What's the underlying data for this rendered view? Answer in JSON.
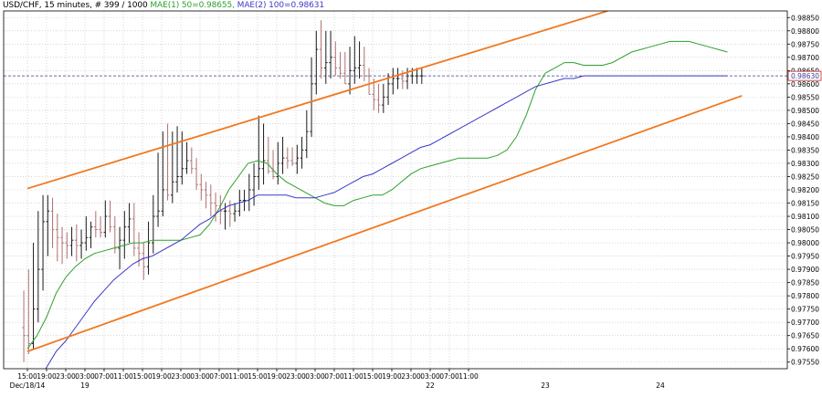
{
  "header": {
    "symbol": "USD/CHF",
    "timeframe": ", 15 minutes",
    "bars": ", # 399 / 1000",
    "mae1": "MAE(1) 50=0.98655,",
    "mae2": "MAE(2) 100=0.98631"
  },
  "colors": {
    "background": "#ffffff",
    "grid": "#c0c0c0",
    "bar": "#1a1a1a",
    "bar_alt": "#b07070",
    "mae50": "#2ca02c",
    "mae100": "#3a3ac8",
    "channel": "#f07820",
    "price_line": "#3a3a9a",
    "price_tag": "#cc2222"
  },
  "chart_data": {
    "type": "line",
    "title": "USD/CHF , 15 minutes , # 399 / 1000",
    "ylim": [
      0.97525,
      0.98875
    ],
    "y_ticks": [
      "0.98850",
      "0.98800",
      "0.98750",
      "0.98700",
      "0.98650",
      "0.98600",
      "0.98550",
      "0.98500",
      "0.98450",
      "0.98400",
      "0.98350",
      "0.98300",
      "0.98250",
      "0.98200",
      "0.98150",
      "0.98100",
      "0.98050",
      "0.98000",
      "0.97950",
      "0.97900",
      "0.97850",
      "0.97800",
      "0.97750",
      "0.97700",
      "0.97650",
      "0.97600",
      "0.97550"
    ],
    "x_ticks": [
      "15:00",
      "19:00",
      "23:00",
      "03:00",
      "07:00",
      "11:00",
      "15:00",
      "19:00",
      "23:00",
      "03:00",
      "07:00",
      "11:00",
      "15:00",
      "19:00",
      "23:00",
      "03:00",
      "07:00",
      "11:00",
      "15:00",
      "19:00",
      "23:00",
      "03:00",
      "07:00",
      "11:00"
    ],
    "x_ticks_start_hour": 15,
    "x_tick_step_hours": 4,
    "day_labels": [
      {
        "label": "Dec/18/14",
        "hour": 15
      },
      {
        "label": "19",
        "hour": 27
      },
      {
        "label": "22",
        "hour": 99
      },
      {
        "label": "23",
        "hour": 123
      },
      {
        "label": "24",
        "hour": 147
      }
    ],
    "current_price": "0.98630",
    "current_value": 0.9863,
    "series": [
      {
        "name": "MAE(1) 50",
        "x": [
          15,
          17,
          19,
          21,
          23,
          25,
          27,
          29,
          31,
          33,
          35,
          37,
          39,
          41,
          43,
          45,
          47,
          49,
          51,
          53,
          55,
          57,
          59,
          61,
          63,
          65,
          67,
          69,
          71,
          73,
          75,
          77,
          79,
          81,
          83,
          85,
          87,
          89,
          91,
          93,
          95,
          97,
          99,
          101,
          103,
          105,
          107,
          109,
          111,
          113,
          115,
          117,
          119,
          121,
          123,
          125,
          127,
          129,
          131,
          133,
          135,
          137,
          139,
          141,
          143,
          145,
          147,
          149,
          151,
          153,
          155,
          157,
          159,
          161
        ],
        "values": [
          0.976,
          0.9765,
          0.9772,
          0.9781,
          0.9787,
          0.9791,
          0.9794,
          0.9796,
          0.9797,
          0.9798,
          0.9799,
          0.98,
          0.98,
          0.9801,
          0.9801,
          0.9801,
          0.9801,
          0.9802,
          0.9803,
          0.9807,
          0.9813,
          0.982,
          0.9825,
          0.983,
          0.9831,
          0.983,
          0.9826,
          0.9823,
          0.9821,
          0.9819,
          0.9817,
          0.9815,
          0.9814,
          0.9814,
          0.9816,
          0.9817,
          0.9818,
          0.9818,
          0.982,
          0.9823,
          0.9826,
          0.9828,
          0.9829,
          0.983,
          0.9831,
          0.9832,
          0.9832,
          0.9832,
          0.9832,
          0.9833,
          0.9835,
          0.984,
          0.9848,
          0.9858,
          0.9864,
          0.9866,
          0.9868,
          0.9868,
          0.9867,
          0.9867,
          0.9867,
          0.9868,
          0.987,
          0.9872,
          0.9873,
          0.9874,
          0.9875,
          0.9876,
          0.9876,
          0.9876,
          0.9875,
          0.9874,
          0.9873,
          0.9872
        ]
      },
      {
        "name": "MAE(2) 100",
        "x": [
          15,
          17,
          19,
          21,
          23,
          25,
          27,
          29,
          31,
          33,
          35,
          37,
          39,
          41,
          43,
          45,
          47,
          49,
          51,
          53,
          55,
          57,
          59,
          61,
          63,
          65,
          67,
          69,
          71,
          73,
          75,
          77,
          79,
          81,
          83,
          85,
          87,
          89,
          91,
          93,
          95,
          97,
          99,
          101,
          103,
          105,
          107,
          109,
          111,
          113,
          115,
          117,
          119,
          121,
          123,
          125,
          127,
          129,
          131,
          133,
          135,
          137,
          139,
          141,
          143,
          145,
          147,
          149,
          151,
          153,
          155,
          157,
          159,
          161
        ],
        "values": [
          0.9743,
          0.9747,
          0.9753,
          0.9759,
          0.9763,
          0.9768,
          0.9773,
          0.9778,
          0.9782,
          0.9786,
          0.9789,
          0.9792,
          0.9794,
          0.9795,
          0.9797,
          0.9799,
          0.9801,
          0.9804,
          0.9807,
          0.9809,
          0.9812,
          0.9814,
          0.9815,
          0.9816,
          0.9818,
          0.9818,
          0.9818,
          0.9818,
          0.9817,
          0.9817,
          0.9817,
          0.9818,
          0.9819,
          0.9821,
          0.9823,
          0.9825,
          0.9826,
          0.9828,
          0.983,
          0.9832,
          0.9834,
          0.9836,
          0.9837,
          0.9839,
          0.9841,
          0.9843,
          0.9845,
          0.9847,
          0.9849,
          0.9851,
          0.9853,
          0.9855,
          0.9857,
          0.9859,
          0.986,
          0.9861,
          0.9862,
          0.9862,
          0.9863,
          0.9863,
          0.9863,
          0.9863,
          0.9863,
          0.9863,
          0.9863,
          0.9863,
          0.9863,
          0.9863,
          0.9863,
          0.9863,
          0.9863,
          0.9863,
          0.9863,
          0.9863
        ]
      }
    ],
    "ohlc": {
      "x_start_hour": 14.25,
      "x_step_hours": 1,
      "open": [
        0.9768,
        0.9765,
        0.9762,
        0.9775,
        0.979,
        0.9808,
        0.9812,
        0.9805,
        0.9802,
        0.98,
        0.9799,
        0.9801,
        0.9799,
        0.98,
        0.9802,
        0.9806,
        0.9805,
        0.9804,
        0.981,
        0.9806,
        0.9798,
        0.9801,
        0.9806,
        0.9809,
        0.9798,
        0.9796,
        0.9791,
        0.98,
        0.981,
        0.9812,
        0.982,
        0.9818,
        0.9823,
        0.9825,
        0.9828,
        0.9831,
        0.9828,
        0.9822,
        0.982,
        0.9818,
        0.9815,
        0.9814,
        0.9812,
        0.9812,
        0.9811,
        0.9812,
        0.9816,
        0.9816,
        0.982,
        0.9825,
        0.9828,
        0.9831,
        0.9827,
        0.9825,
        0.983,
        0.9832,
        0.9831,
        0.983,
        0.9832,
        0.9835,
        0.9842,
        0.986,
        0.9873,
        0.9866,
        0.9868,
        0.987,
        0.9866,
        0.9864,
        0.986,
        0.9865,
        0.9866,
        0.9867,
        0.9863,
        0.9856,
        0.9854,
        0.9852,
        0.9855,
        0.986,
        0.9862,
        0.9862,
        0.9861,
        0.9863,
        0.9863,
        0.9863
      ],
      "high": [
        0.9782,
        0.979,
        0.98,
        0.9812,
        0.9818,
        0.9818,
        0.9817,
        0.9811,
        0.9806,
        0.9804,
        0.9806,
        0.9807,
        0.9805,
        0.981,
        0.9808,
        0.9812,
        0.981,
        0.9816,
        0.9816,
        0.981,
        0.9806,
        0.9812,
        0.9815,
        0.9815,
        0.9804,
        0.98,
        0.9808,
        0.9818,
        0.9834,
        0.9842,
        0.9845,
        0.9842,
        0.9844,
        0.9842,
        0.9838,
        0.9836,
        0.9832,
        0.9826,
        0.9823,
        0.9822,
        0.9819,
        0.9818,
        0.9815,
        0.9816,
        0.9815,
        0.982,
        0.982,
        0.9826,
        0.983,
        0.9848,
        0.9845,
        0.984,
        0.9835,
        0.9838,
        0.984,
        0.9836,
        0.9836,
        0.9837,
        0.984,
        0.985,
        0.987,
        0.988,
        0.9884,
        0.988,
        0.988,
        0.9876,
        0.9872,
        0.9872,
        0.9874,
        0.9878,
        0.9876,
        0.9874,
        0.9866,
        0.9862,
        0.986,
        0.986,
        0.9864,
        0.9866,
        0.9866,
        0.9865,
        0.9866,
        0.9866,
        0.9866,
        0.9866
      ],
      "low": [
        0.9755,
        0.9758,
        0.976,
        0.977,
        0.9782,
        0.9795,
        0.9798,
        0.9793,
        0.9792,
        0.9794,
        0.9795,
        0.9793,
        0.9794,
        0.9797,
        0.9798,
        0.9802,
        0.9802,
        0.9802,
        0.9804,
        0.9796,
        0.979,
        0.9794,
        0.98,
        0.9795,
        0.9791,
        0.9786,
        0.9788,
        0.9796,
        0.9806,
        0.981,
        0.9816,
        0.9815,
        0.9819,
        0.9822,
        0.9826,
        0.9826,
        0.982,
        0.9816,
        0.9813,
        0.981,
        0.9808,
        0.9807,
        0.9805,
        0.9806,
        0.9808,
        0.981,
        0.9812,
        0.9812,
        0.9814,
        0.982,
        0.9822,
        0.9826,
        0.9824,
        0.9822,
        0.9826,
        0.9828,
        0.9829,
        0.9826,
        0.9828,
        0.9832,
        0.984,
        0.9856,
        0.9862,
        0.986,
        0.9862,
        0.9863,
        0.9862,
        0.986,
        0.9856,
        0.986,
        0.9862,
        0.9861,
        0.9856,
        0.985,
        0.9849,
        0.9849,
        0.9852,
        0.9856,
        0.9858,
        0.9858,
        0.9858,
        0.986,
        0.986,
        0.986
      ],
      "close": [
        0.9765,
        0.9762,
        0.9775,
        0.979,
        0.9808,
        0.9812,
        0.9805,
        0.9802,
        0.98,
        0.9799,
        0.9801,
        0.9799,
        0.98,
        0.9802,
        0.9806,
        0.9805,
        0.9804,
        0.981,
        0.9806,
        0.9798,
        0.9801,
        0.9806,
        0.9809,
        0.9798,
        0.9796,
        0.9791,
        0.98,
        0.981,
        0.9812,
        0.982,
        0.9818,
        0.9823,
        0.9825,
        0.9828,
        0.9831,
        0.9828,
        0.9822,
        0.982,
        0.9818,
        0.9815,
        0.9814,
        0.9812,
        0.9812,
        0.9811,
        0.9812,
        0.9816,
        0.9816,
        0.982,
        0.9825,
        0.9828,
        0.9831,
        0.9827,
        0.9825,
        0.983,
        0.9832,
        0.9831,
        0.983,
        0.9832,
        0.9835,
        0.9842,
        0.986,
        0.9873,
        0.9866,
        0.9868,
        0.987,
        0.9866,
        0.9864,
        0.986,
        0.9865,
        0.9866,
        0.9867,
        0.9863,
        0.9856,
        0.9854,
        0.9852,
        0.9855,
        0.986,
        0.9862,
        0.9862,
        0.9861,
        0.9863,
        0.9863,
        0.9863,
        0.9863
      ]
    },
    "channel_lines": [
      {
        "name": "upper",
        "x": [
          15,
          136
        ],
        "values": [
          0.98205,
          0.98875
        ]
      },
      {
        "name": "lower",
        "x": [
          15,
          164
        ],
        "values": [
          0.9759,
          0.98555
        ]
      }
    ],
    "grid": true
  }
}
